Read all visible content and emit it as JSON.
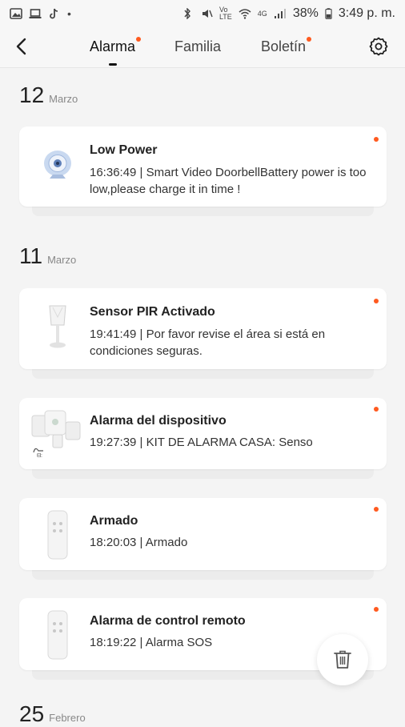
{
  "status_bar": {
    "battery": "38%",
    "time": "3:49 p. m.",
    "network": "4G"
  },
  "header": {
    "tabs": [
      {
        "label": "Alarma",
        "active": true,
        "unread": true
      },
      {
        "label": "Familia",
        "active": false,
        "unread": false
      },
      {
        "label": "Boletín",
        "active": false,
        "unread": true
      }
    ]
  },
  "groups": [
    {
      "day": "12",
      "month": "Marzo",
      "items": [
        {
          "title": "Low Power",
          "description": "16:36:49 |  Smart Video DoorbellBattery power is too low,please charge it in time !",
          "icon": "doorbell-camera-icon",
          "unread": true
        }
      ]
    },
    {
      "day": "11",
      "month": "Marzo",
      "items": [
        {
          "title": "Sensor PIR Activado",
          "description": "19:41:49 | Por favor revise el área si está en condiciones seguras.",
          "icon": "pir-sensor-icon",
          "unread": true
        },
        {
          "title": "Alarma del dispositivo",
          "description": "19:27:39 | KIT DE ALARMA CASA:  Senso",
          "icon": "alarm-kit-icon",
          "unread": true
        },
        {
          "title": "Armado",
          "description": "18:20:03 | Armado",
          "icon": "remote-control-icon",
          "unread": true
        },
        {
          "title": "Alarma de control remoto",
          "description": "18:19:22 | Alarma SOS",
          "icon": "remote-control-icon",
          "unread": true
        }
      ]
    },
    {
      "day": "25",
      "month": "Febrero",
      "items": []
    }
  ],
  "colors": {
    "accent_dot": "#ff5a1f",
    "background": "#f4f4f4"
  }
}
